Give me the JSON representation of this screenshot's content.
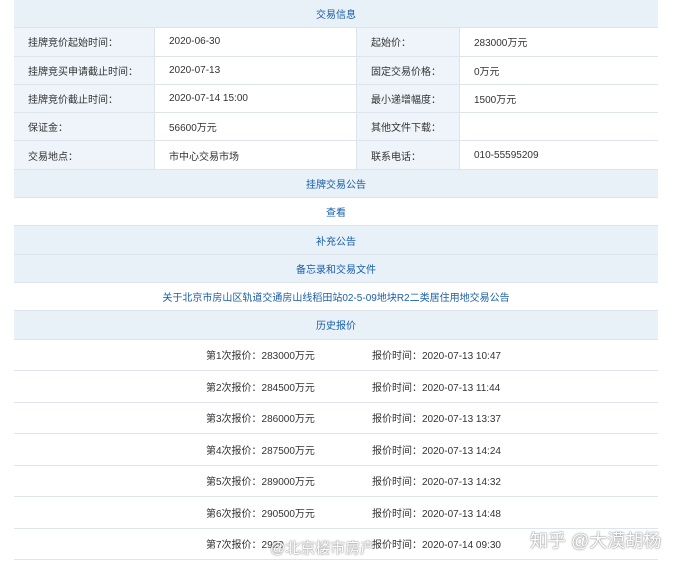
{
  "info": {
    "title": "交易信息",
    "rows": [
      {
        "l1": "挂牌竞价起始时间：",
        "v1": "2020-06-30",
        "l2": "起始价：",
        "v2": "283000万元"
      },
      {
        "l1": "挂牌竞买申请截止时间：",
        "v1": "2020-07-13",
        "l2": "固定交易价格：",
        "v2": "0万元"
      },
      {
        "l1": "挂牌竞价截止时间：",
        "v1": "2020-07-14 15:00",
        "l2": "最小递增幅度：",
        "v2": "1500万元"
      },
      {
        "l1": "保证金：",
        "v1": "56600万元",
        "l2": "其他文件下载：",
        "v2": ""
      },
      {
        "l1": "交易地点：",
        "v1": "市中心交易市场",
        "l2": "联系电话：",
        "v2": "010-55595209"
      }
    ]
  },
  "notice": {
    "title": "挂牌交易公告",
    "view": "查看",
    "supplement": "补充公告",
    "memo": "备忘录和交易文件",
    "memo_link": "关于北京市房山区轨道交通房山线稻田站02-5-09地块R2二类居住用地交易公告"
  },
  "history": {
    "title": "历史报价",
    "bids": [
      {
        "amount": "第1次报价：283000万元",
        "time": "报价时间：2020-07-13 10:47"
      },
      {
        "amount": "第2次报价：284500万元",
        "time": "报价时间：2020-07-13 11:44"
      },
      {
        "amount": "第3次报价：286000万元",
        "time": "报价时间：2020-07-13 13:37"
      },
      {
        "amount": "第4次报价：287500万元",
        "time": "报价时间：2020-07-13 14:24"
      },
      {
        "amount": "第5次报价：289000万元",
        "time": "报价时间：2020-07-13 14:32"
      },
      {
        "amount": "第6次报价：290500万元",
        "time": "报价时间：2020-07-13 14:48"
      },
      {
        "amount": "第7次报价：2920",
        "time": "报价时间：2020-07-14 09:30"
      }
    ]
  },
  "watermarks": {
    "weibo": "@北京楼市房产",
    "zhihu": "知乎 @大漠胡杨"
  }
}
